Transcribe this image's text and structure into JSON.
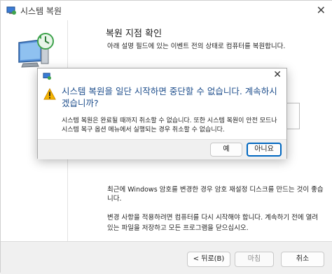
{
  "window": {
    "title": "시스템 복원",
    "close_glyph": "✕"
  },
  "main": {
    "heading": "복원 지점 확인",
    "description": "아래 설명 필드에 있는 이벤트 전의 상태로 컴퓨터를 복원합니다.",
    "paragraph1": "최근에 Windows 암호를 변경한 경우 암호 재설정 디스크를 만드는 것이 좋습니다.",
    "paragraph2": "변경 사항을 적용하려면 컴퓨터를 다시 시작해야 합니다. 계속하기 전에 열려 있는 파일을 저장하고 모든 프로그램을 닫으십시오."
  },
  "footer": {
    "back_label": "< 뒤로(B)",
    "finish_label": "마침",
    "cancel_label": "취소"
  },
  "dialog": {
    "close_glyph": "✕",
    "main_instruction": "시스템 복원을 일단 시작하면 중단할 수 없습니다. 계속하시겠습니까?",
    "content": "시스템 복원은 완료될 때까지 취소할 수 없습니다. 또한 시스템 복원이 안전 모드나 시스템 복구 옵션 메뉴에서 실행되는 경우 취소할 수 없습니다.",
    "yes_label": "예",
    "no_label": "아니요"
  },
  "icons": {
    "app": "system-restore-icon",
    "sidebar": "computer-restore-icon",
    "warning": "warning-icon"
  },
  "colors": {
    "accent": "#0067c0",
    "instruction_text": "#1e4e8c",
    "warning": "#f5b400"
  }
}
